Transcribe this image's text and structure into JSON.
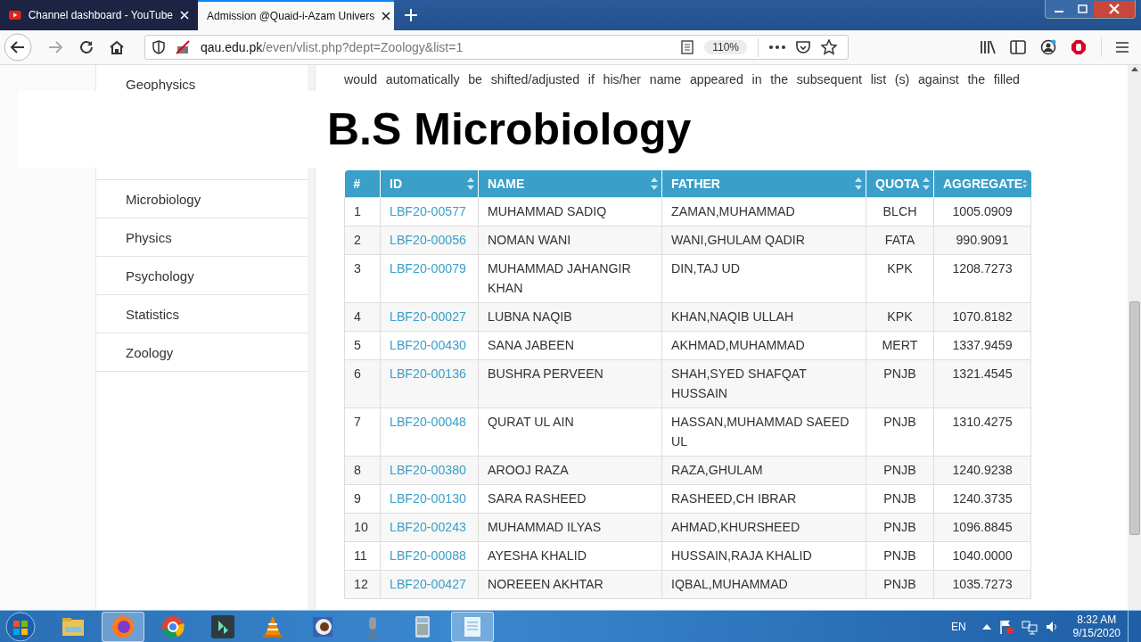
{
  "browser": {
    "tabs": [
      {
        "title": "Channel dashboard - YouTube",
        "kind": "youtube",
        "selected": false
      },
      {
        "title": "Admission @Quaid-i-Azam Univers",
        "kind": "page",
        "selected": true
      }
    ],
    "address": {
      "domain": "qau.edu.pk",
      "path": "/even/vlist.php?dept=Zoology&list=1"
    },
    "zoom": "110%"
  },
  "sidebar": {
    "items": [
      {
        "label": "Geophysics"
      },
      {
        "label": "Microbiology"
      },
      {
        "label": "Physics"
      },
      {
        "label": "Psychology"
      },
      {
        "label": "Statistics"
      },
      {
        "label": "Zoology"
      }
    ]
  },
  "paragraph": "would automatically be shifted/adjusted if his/her name appeared in the subsequent list (s) against the filled",
  "banner": "B.S Microbiology",
  "table": {
    "columns": [
      {
        "label": "#",
        "sortable": false
      },
      {
        "label": "ID",
        "sortable": true
      },
      {
        "label": "NAME",
        "sortable": true
      },
      {
        "label": "FATHER",
        "sortable": true
      },
      {
        "label": "QUOTA",
        "sortable": true
      },
      {
        "label": "AGGREGATE",
        "sortable": true
      }
    ],
    "rows": [
      [
        "1",
        "LBF20-00577",
        "MUHAMMAD SADIQ",
        "ZAMAN,MUHAMMAD",
        "BLCH",
        "1005.0909"
      ],
      [
        "2",
        "LBF20-00056",
        "NOMAN WANI",
        "WANI,GHULAM QADIR",
        "FATA",
        "990.9091"
      ],
      [
        "3",
        "LBF20-00079",
        "MUHAMMAD JAHANGIR KHAN",
        "DIN,TAJ UD",
        "KPK",
        "1208.7273"
      ],
      [
        "4",
        "LBF20-00027",
        "LUBNA NAQIB",
        "KHAN,NAQIB ULLAH",
        "KPK",
        "1070.8182"
      ],
      [
        "5",
        "LBF20-00430",
        "SANA JABEEN",
        "AKHMAD,MUHAMMAD",
        "MERT",
        "1337.9459"
      ],
      [
        "6",
        "LBF20-00136",
        "BUSHRA PERVEEN",
        "SHAH,SYED SHAFQAT HUSSAIN",
        "PNJB",
        "1321.4545"
      ],
      [
        "7",
        "LBF20-00048",
        "QURAT UL AIN",
        "HASSAN,MUHAMMAD SAEED UL",
        "PNJB",
        "1310.4275"
      ],
      [
        "8",
        "LBF20-00380",
        "AROOJ RAZA",
        "RAZA,GHULAM",
        "PNJB",
        "1240.9238"
      ],
      [
        "9",
        "LBF20-00130",
        "SARA RASHEED",
        "RASHEED,CH IBRAR",
        "PNJB",
        "1240.3735"
      ],
      [
        "10",
        "LBF20-00243",
        "MUHAMMAD ILYAS",
        "AHMAD,KHURSHEED",
        "PNJB",
        "1096.8845"
      ],
      [
        "11",
        "LBF20-00088",
        "AYESHA KHALID",
        "HUSSAIN,RAJA KHALID",
        "PNJB",
        "1040.0000"
      ],
      [
        "12",
        "LBF20-00427",
        "NOREEEN AKHTAR",
        "IQBAL,MUHAMMAD",
        "PNJB",
        "1035.7273"
      ]
    ]
  },
  "taskbar": {
    "apps": [
      {
        "kind": "folder",
        "selected": false
      },
      {
        "kind": "firefox",
        "selected": true
      },
      {
        "kind": "chrome",
        "selected": false
      },
      {
        "kind": "editor",
        "selected": false
      },
      {
        "kind": "vlc",
        "selected": false
      },
      {
        "kind": "media",
        "selected": false
      },
      {
        "kind": "microphone",
        "selected": false
      },
      {
        "kind": "calculator",
        "selected": false
      },
      {
        "kind": "notepad",
        "selected": true
      }
    ],
    "language": "EN",
    "time": "8:32 AM",
    "date": "9/15/2020"
  }
}
